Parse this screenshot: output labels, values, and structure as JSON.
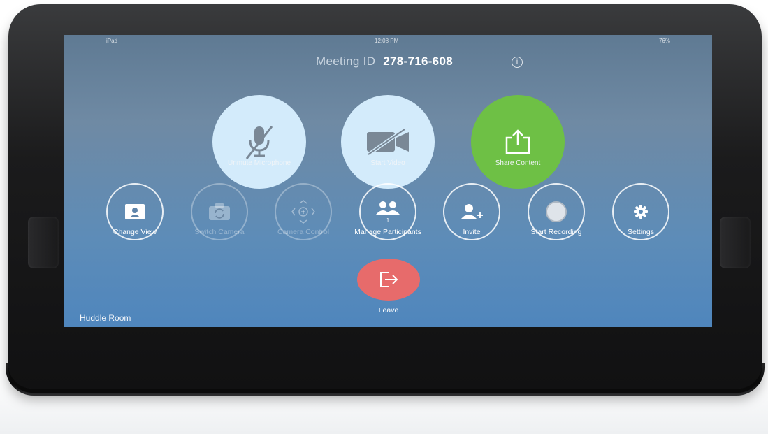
{
  "status_bar": {
    "left": "iPad",
    "time": "12:08 PM",
    "battery": "76%"
  },
  "meeting": {
    "label": "Meeting ID",
    "id": "278-716-608"
  },
  "primary_actions": [
    {
      "label": "Unmute Microphone"
    },
    {
      "label": "Start Video"
    },
    {
      "label": "Share Content"
    }
  ],
  "secondary_actions": [
    {
      "label": "Change View"
    },
    {
      "label": "Switch Camera"
    },
    {
      "label": "Camera Control"
    },
    {
      "label": "Manage Participants",
      "count": "1"
    },
    {
      "label": "Invite"
    },
    {
      "label": "Start Recording"
    },
    {
      "label": "Settings"
    }
  ],
  "leave": {
    "label": "Leave"
  },
  "room_name": "Huddle Room",
  "colors": {
    "share": "#6ec045",
    "leave": "#e76b6b",
    "light_button": "#d3ebfb"
  },
  "icons": [
    "muted-microphone-icon",
    "video-off-icon",
    "share-upload-icon",
    "change-view-icon",
    "switch-camera-icon",
    "camera-control-icon",
    "participants-icon",
    "invite-icon",
    "record-icon",
    "gear-icon",
    "leave-icon",
    "info-icon"
  ]
}
